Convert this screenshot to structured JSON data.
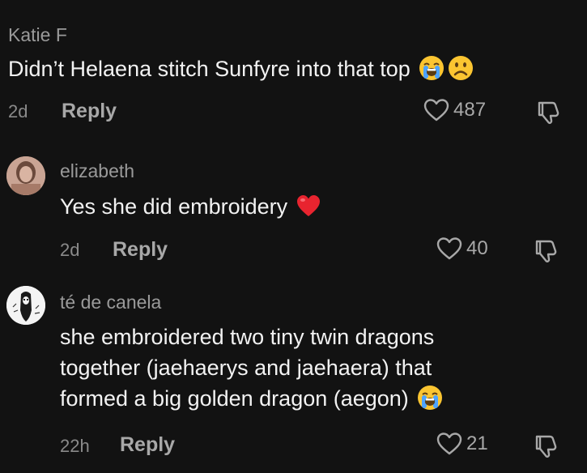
{
  "comments": [
    {
      "username": "Katie F",
      "text_lines": [
        "Didn’t Helaena stitch Sunfyre into that top"
      ],
      "emojis": [
        "loudly-crying-face",
        "frowning-face"
      ],
      "time": "2d",
      "reply_label": "Reply",
      "likes": "487"
    },
    {
      "username": "elizabeth",
      "text_lines": [
        "Yes she did embroidery"
      ],
      "emojis": [
        "red-heart"
      ],
      "time": "2d",
      "reply_label": "Reply",
      "likes": "40"
    },
    {
      "username": "té de canela",
      "text_lines": [
        "she embroidered two tiny twin dragons",
        "together (jaehaerys and jaehaera) that",
        "formed a big golden dragon (aegon)"
      ],
      "emojis": [
        "loudly-crying-face"
      ],
      "time": "22h",
      "reply_label": "Reply",
      "likes": "21"
    }
  ],
  "colors": {
    "background": "#121212",
    "primary_text": "#f2f2f2",
    "secondary_text": "#9a9a9a",
    "icon": "#a8a8a8",
    "heart_emoji": "#e8242f",
    "face_emoji": "#fbc531"
  }
}
